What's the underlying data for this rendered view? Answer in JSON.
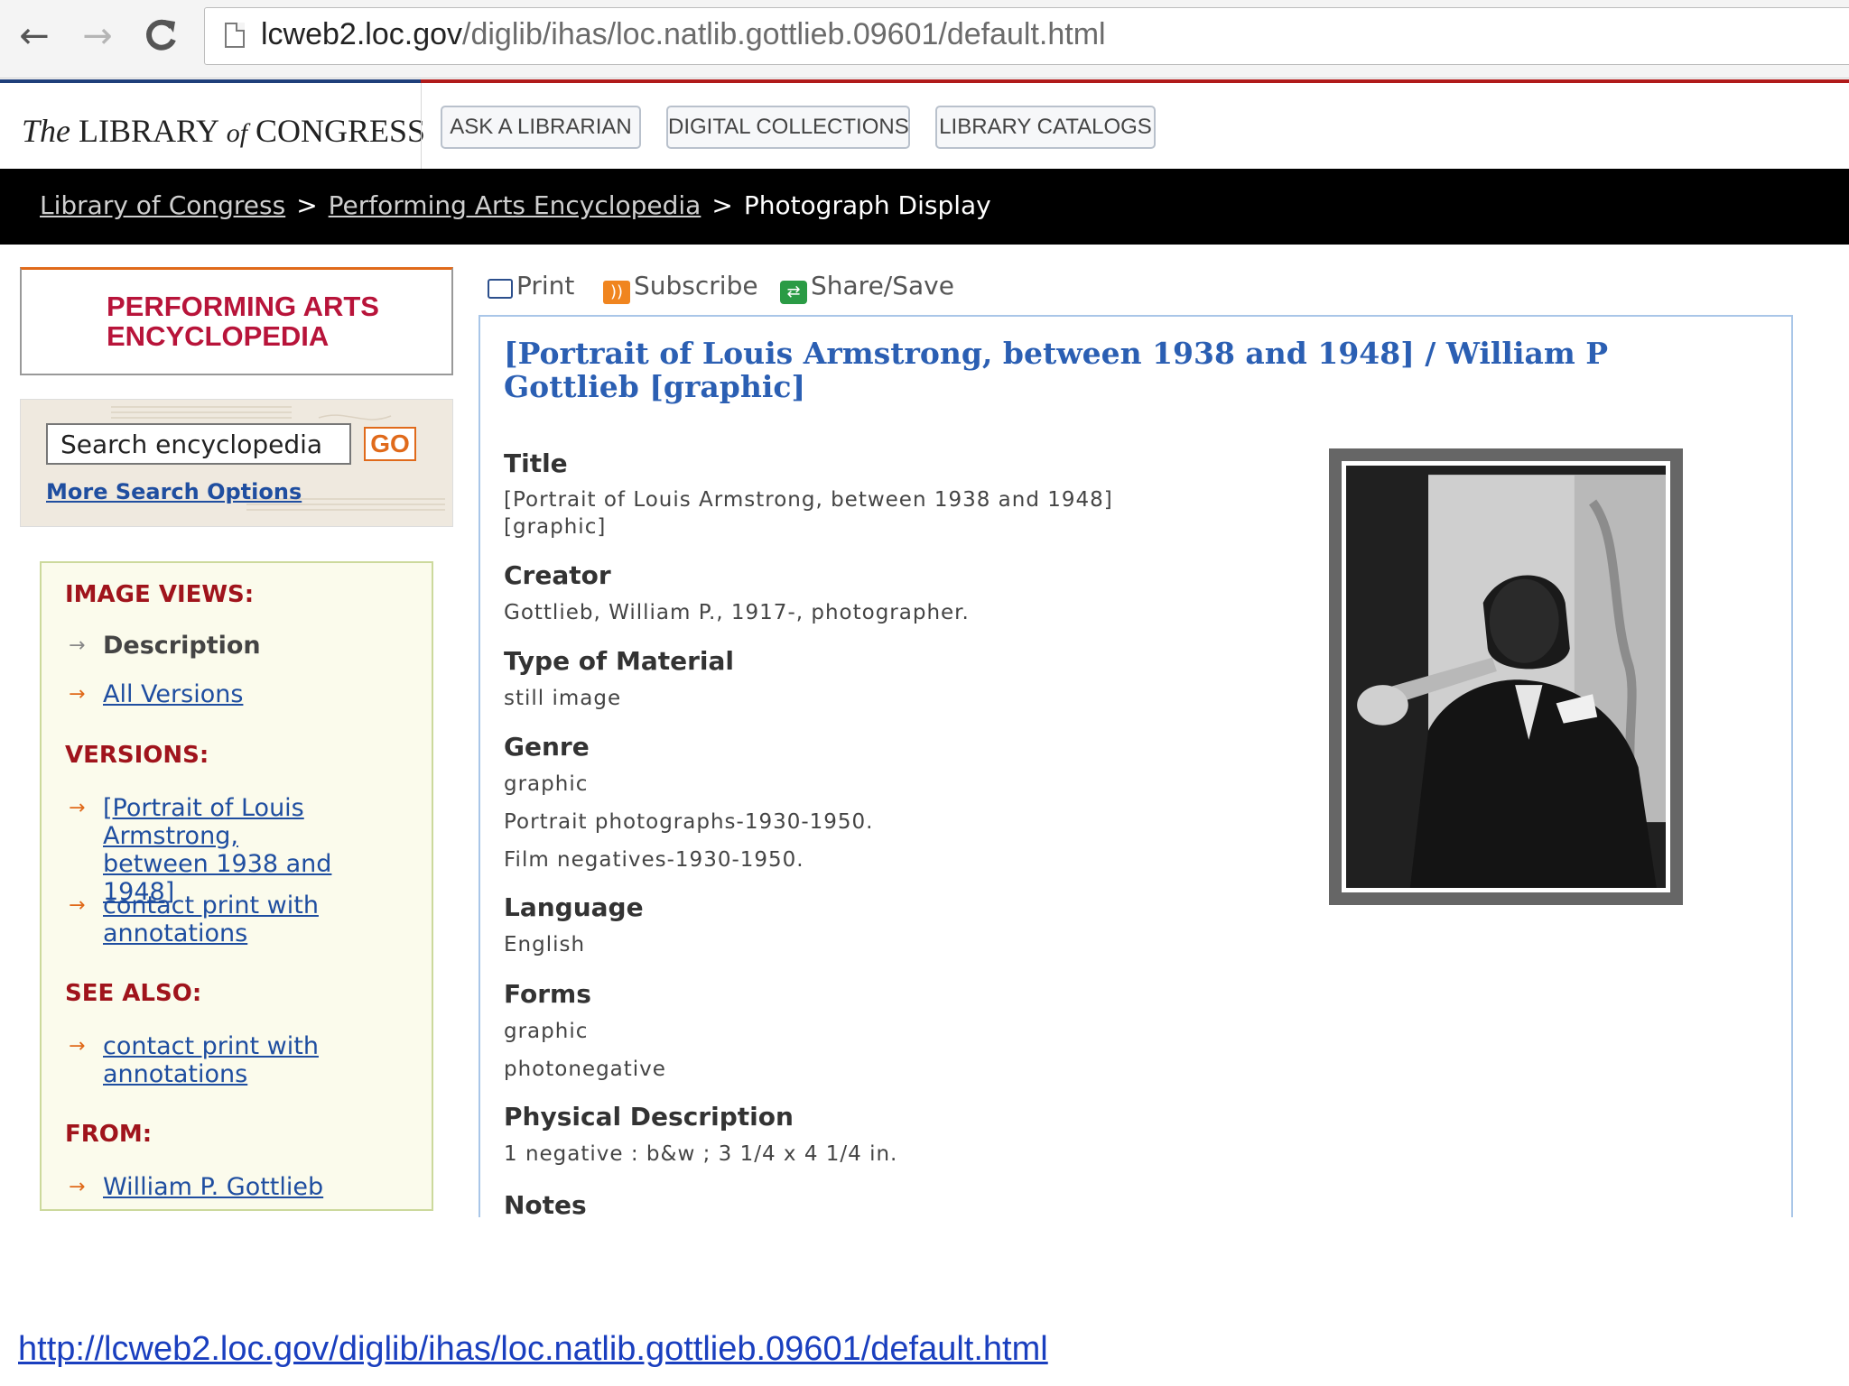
{
  "browser": {
    "url_host": "lcweb2.loc.gov",
    "url_path": "/diglib/ihas/loc.natlib.gottlieb.09601/default.html",
    "back_icon": "←",
    "forward_icon": "→",
    "reload_icon": "C"
  },
  "header": {
    "logo_the": "The",
    "logo_library": "LIBRARY",
    "logo_of": "of",
    "logo_congress": "CONGRESS",
    "buttons": [
      "ASK A LIBRARIAN",
      "DIGITAL COLLECTIONS",
      "LIBRARY CATALOGS"
    ]
  },
  "breadcrumb": {
    "items": [
      "Library of Congress",
      "Performing Arts Encyclopedia"
    ],
    "separator": ">",
    "current": "Photograph Display"
  },
  "sidebar": {
    "pae_title_line1": "PERFORMING ARTS",
    "pae_title_line2": "ENCYCLOPEDIA",
    "search_value": "Search encyclopedia",
    "go_label": "GO",
    "more_search": "More Search Options",
    "image_views_head": "IMAGE VIEWS:",
    "image_views": [
      "Description",
      "All Versions"
    ],
    "versions_head": "VERSIONS:",
    "versions": [
      "[Portrait of Louis Armstrong, between 1938 and 1948]",
      "contact print with annotations"
    ],
    "see_also_head": "SEE ALSO:",
    "see_also": [
      "contact print with annotations"
    ],
    "from_head": "FROM:",
    "from": [
      "William P. Gottlieb"
    ]
  },
  "tools": {
    "print": "Print",
    "subscribe": "Subscribe",
    "share": "Share/Save"
  },
  "record": {
    "title": "[Portrait of Louis Armstrong, between 1938 and 1948] / William P Gottlieb [graphic]",
    "fields": {
      "title_label": "Title",
      "title_value": "[Portrait of Louis Armstrong, between 1938 and 1948] [graphic]",
      "creator_label": "Creator",
      "creator_value": "Gottlieb, William P., 1917-, photographer.",
      "type_label": "Type of Material",
      "type_value": "still image",
      "genre_label": "Genre",
      "genre_values": [
        "graphic",
        "Portrait photographs-1930-1950.",
        "Film negatives-1930-1950."
      ],
      "language_label": "Language",
      "language_value": "English",
      "forms_label": "Forms",
      "forms_values": [
        "graphic",
        "photonegative"
      ],
      "physical_label": "Physical Description",
      "physical_value": "1 negative : b&w ; 3 1/4 x 4 1/4 in.",
      "notes_label": "Notes"
    }
  },
  "footer": {
    "url": "http://lcweb2.loc.gov/diglib/ihas/loc.natlib.gottlieb.09601/default.html"
  }
}
